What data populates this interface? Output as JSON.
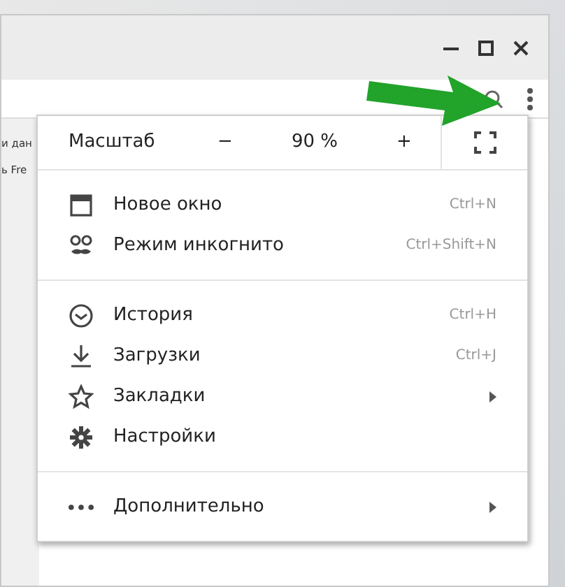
{
  "page_fragments": [
    "и дан",
    "ь Fre"
  ],
  "menu": {
    "zoom": {
      "label": "Масштаб",
      "decrease": "−",
      "value": "90 %",
      "increase": "+"
    },
    "sections": [
      {
        "items": [
          {
            "kind": "window",
            "label": "Новое окно",
            "shortcut": "Ctrl+N",
            "submenu": false
          },
          {
            "kind": "incognito",
            "label": "Режим инкогнито",
            "shortcut": "Ctrl+Shift+N",
            "submenu": false
          }
        ]
      },
      {
        "items": [
          {
            "kind": "history",
            "label": "История",
            "shortcut": "Ctrl+H",
            "submenu": false
          },
          {
            "kind": "download",
            "label": "Загрузки",
            "shortcut": "Ctrl+J",
            "submenu": false
          },
          {
            "kind": "star",
            "label": "Закладки",
            "submenu": true
          },
          {
            "kind": "gear",
            "label": "Настройки",
            "submenu": false
          }
        ]
      },
      {
        "items": [
          {
            "kind": "more",
            "label": "Дополнительно",
            "submenu": true
          }
        ]
      }
    ]
  }
}
